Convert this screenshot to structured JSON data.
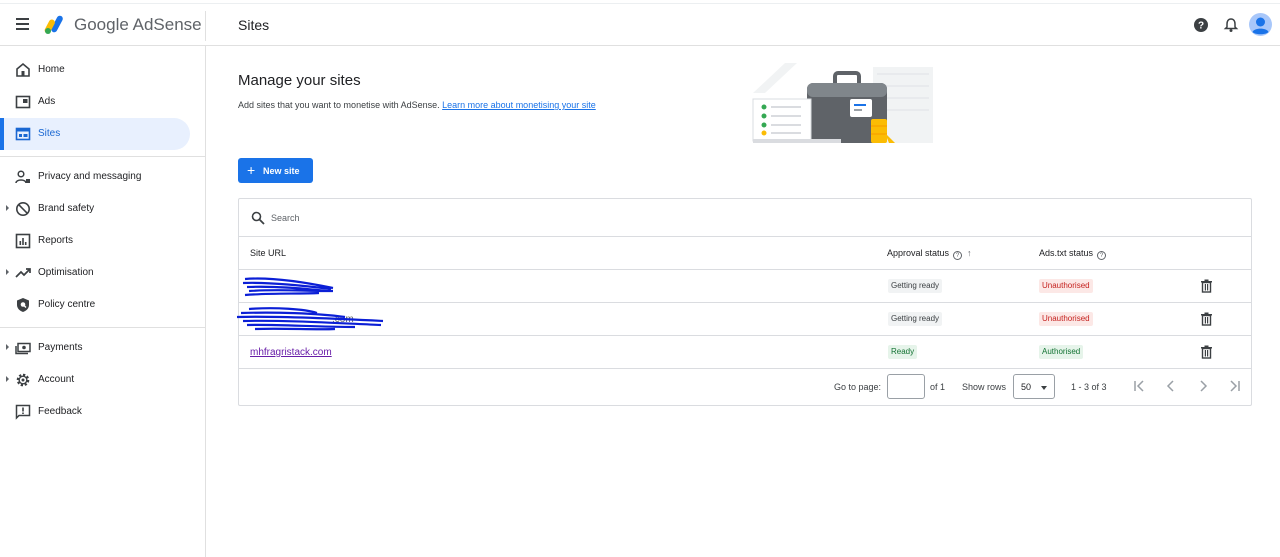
{
  "app": {
    "brand": "Google AdSense",
    "section_title": "Sites"
  },
  "sidebar": {
    "items": [
      {
        "label": "Home"
      },
      {
        "label": "Ads"
      },
      {
        "label": "Sites"
      },
      {
        "label": "Privacy and messaging"
      },
      {
        "label": "Brand safety"
      },
      {
        "label": "Reports"
      },
      {
        "label": "Optimisation"
      },
      {
        "label": "Policy centre"
      },
      {
        "label": "Payments"
      },
      {
        "label": "Account"
      },
      {
        "label": "Feedback"
      }
    ]
  },
  "main": {
    "title": "Manage your sites",
    "subtitle": "Add sites that you want to monetise with AdSense.",
    "learn_more": "Learn more about monetising your site",
    "new_site_label": "New site",
    "search_placeholder": "Search",
    "columns": {
      "url": "Site URL",
      "approval": "Approval status",
      "ads_txt": "Ads.txt status"
    },
    "rows": [
      {
        "url": "",
        "approval": "Getting ready",
        "ads_txt": "Unauthorised"
      },
      {
        "url": ".com",
        "approval": "Getting ready",
        "ads_txt": "Unauthorised"
      },
      {
        "url": "mhfragristack.com",
        "approval": "Ready",
        "ads_txt": "Authorised"
      }
    ],
    "pagination": {
      "go_to_page": "Go to page:",
      "of_pages": "of 1",
      "show_rows": "Show rows",
      "rows_value": "50",
      "range": "1 - 3 of 3"
    }
  },
  "colors": {
    "primary": "#1a73e8",
    "unauthorised": "#c5221f",
    "authorised": "#137333",
    "redaction": "#0b1fd6"
  }
}
